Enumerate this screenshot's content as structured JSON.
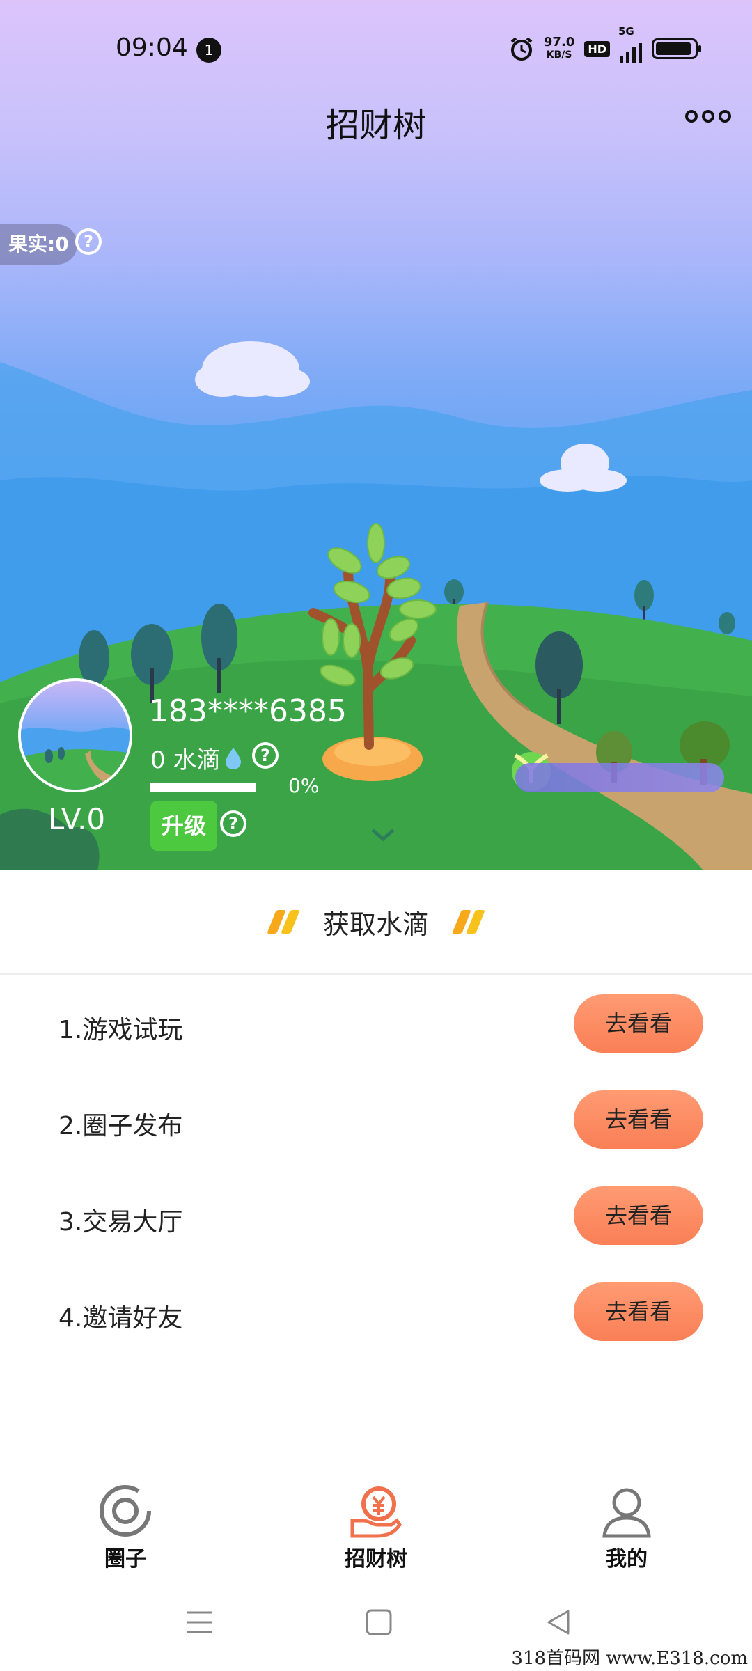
{
  "status_bar": {
    "time": "09:04",
    "notification_count": "1",
    "net_speed_value": "97.0",
    "net_speed_unit": "KB/S",
    "hd_label": "HD",
    "network": "5G",
    "icons": [
      "alarm-icon",
      "hd-icon",
      "signal-icon",
      "battery-icon"
    ]
  },
  "header": {
    "title": "招财树",
    "more_icon": "more-dots-icon"
  },
  "scene": {
    "fruit_label": "果实:0",
    "user_id": "183****6385",
    "water": "0 水滴",
    "progress_text": "0%",
    "progress": 0,
    "upgrade_label": "升级",
    "level": "LV.0"
  },
  "section": {
    "title": "获取水滴"
  },
  "tasks": [
    {
      "label": "1.游戏试玩",
      "button": "去看看"
    },
    {
      "label": "2.圈子发布",
      "button": "去看看"
    },
    {
      "label": "3.交易大厅",
      "button": "去看看"
    },
    {
      "label": "4.邀请好友",
      "button": "去看看"
    }
  ],
  "bottom_nav": [
    {
      "label": "圈子",
      "icon": "circle-icon",
      "active": false
    },
    {
      "label": "招财树",
      "icon": "money-hand-icon",
      "active": true
    },
    {
      "label": "我的",
      "icon": "user-icon",
      "active": false
    }
  ],
  "colors": {
    "accent": "#f0714b",
    "button_orange": "#fa7f56",
    "upgrade_green": "#4cc93f",
    "nav_inactive": "#111111"
  },
  "watermark": "318首码网 www.E318.com"
}
